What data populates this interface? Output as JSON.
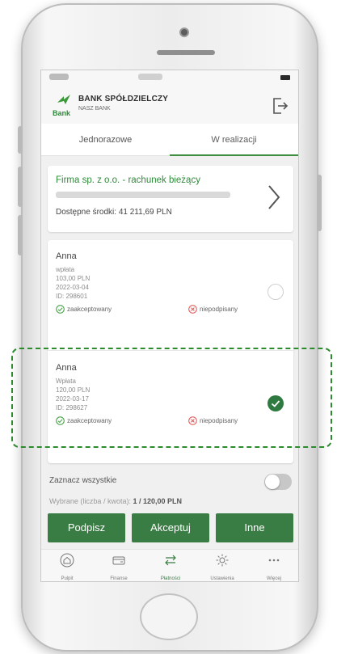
{
  "bank": {
    "title": "BANK SPÓŁDZIELCZY",
    "subtitle": "NASZ BANK",
    "logo_text": "Bank"
  },
  "tabs": [
    {
      "label": "Jednorazowe"
    },
    {
      "label": "W realizacji"
    }
  ],
  "account": {
    "name": "Firma sp. z o.o. - rachunek bieżący",
    "balance": "Dostępne środki: 41 211,69 PLN"
  },
  "transactions": [
    {
      "name": "Anna",
      "type": "wpłata",
      "amount": "103,00 PLN",
      "date": "2022-03-04",
      "id": "ID: 298601",
      "status_ok": "zaakceptowany",
      "status_no": "niepodpisany",
      "selected": false
    },
    {
      "name": "Anna",
      "type": "Wpłata",
      "amount": "120,00 PLN",
      "date": "2022-03-17",
      "id": "ID: 298627",
      "status_ok": "zaakceptowany",
      "status_no": "niepodpisany",
      "selected": true
    }
  ],
  "select_all": {
    "label": "Zaznacz wszystkie",
    "on": false
  },
  "selected_info": {
    "label": "Wybrane (liczba / kwota):",
    "value": "1 / 120,00 PLN"
  },
  "buttons": {
    "sign": "Podpisz",
    "accept": "Akceptuj",
    "other": "Inne"
  },
  "nav": [
    {
      "label": "Pulpit",
      "icon": "home-icon"
    },
    {
      "label": "Finanse",
      "icon": "wallet-icon"
    },
    {
      "label": "Płatności",
      "icon": "transfer-icon",
      "active": true
    },
    {
      "label": "Ustawienia",
      "icon": "gear-icon"
    },
    {
      "label": "Więcej",
      "icon": "more-icon"
    }
  ],
  "colors": {
    "accent": "#3a7d44",
    "account_name": "#2f8a3a",
    "highlight": "#2e8a2e",
    "reject": "#e05050"
  }
}
